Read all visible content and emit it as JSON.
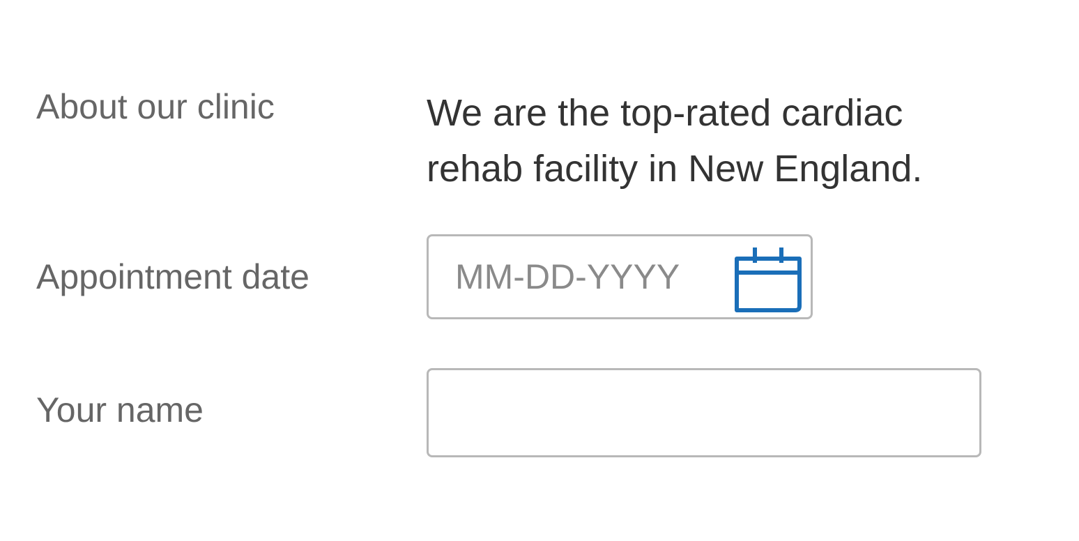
{
  "form": {
    "about": {
      "label": "About our clinic",
      "text_lines": [
        "We are the top-rated cardiac",
        "rehab facility in New England."
      ]
    },
    "appointment_date": {
      "label": "Appointment date",
      "placeholder": "MM-DD-YYYY",
      "value": "",
      "icon": "calendar-icon"
    },
    "your_name": {
      "label": "Your name",
      "value": "",
      "placeholder": ""
    }
  },
  "colors": {
    "label_text": "#666666",
    "body_text": "#333333",
    "placeholder_text": "#8a8a8a",
    "input_border": "#b8b8b8",
    "accent": "#1a6eb8"
  }
}
